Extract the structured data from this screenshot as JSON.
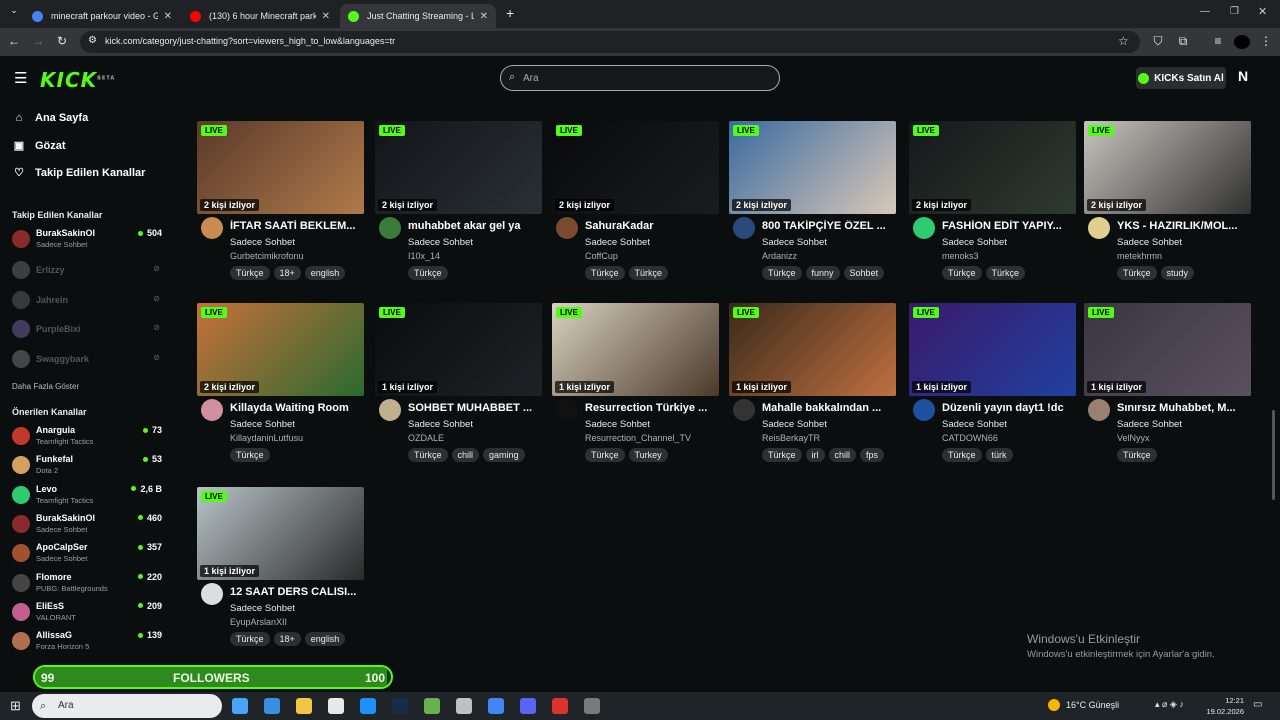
{
  "browser": {
    "tabs": [
      {
        "title": "minecraft parkour video - Google",
        "fav": "#4285f4",
        "active": false
      },
      {
        "title": "(130) 6 hour Minecraft parkour",
        "fav": "#ff0000",
        "active": false
      },
      {
        "title": "Just Chatting Streaming - Live S",
        "fav": "#53fc18",
        "active": true
      }
    ],
    "url": "kick.com/category/just-chatting?sort=viewers_high_to_low&languages=tr",
    "new_tab": "+"
  },
  "header": {
    "logo": "KICK",
    "logo_tag": "BETA",
    "search_placeholder": "Ara",
    "kicks_button": "KICKs Satın Al",
    "user_initial": "N"
  },
  "sidebar": {
    "nav": [
      {
        "label": "Ana Sayfa",
        "icon": "home-icon"
      },
      {
        "label": "Gözat",
        "icon": "browse-icon"
      },
      {
        "label": "Takip Edilen Kanallar",
        "icon": "heart-icon"
      }
    ],
    "followed_title": "Takip Edilen Kanallar",
    "followed": [
      {
        "name": "BurakSakinOl",
        "sub": "Sadece Sohbet",
        "viewers": "504",
        "online": true,
        "color": "#8b2a2a"
      },
      {
        "name": "Erlizzy",
        "online": false,
        "color": "#888"
      },
      {
        "name": "Jahrein",
        "online": false,
        "color": "#777"
      },
      {
        "name": "PurpleBixi",
        "online": false,
        "color": "#9b7fd0"
      },
      {
        "name": "Swaggybark",
        "online": false,
        "color": "#999"
      }
    ],
    "more_label": "Daha Fazla Göster",
    "suggested_title": "Önerilen Kanallar",
    "suggested": [
      {
        "name": "Anarguia",
        "sub": "Teamfight Tactics",
        "viewers": "73",
        "color": "#c0392b"
      },
      {
        "name": "Funkefal",
        "sub": "Dota 2",
        "viewers": "53",
        "color": "#d4a060"
      },
      {
        "name": "Levo",
        "sub": "Teamfight Tactics",
        "viewers": "2,6 B",
        "color": "#2ecc71"
      },
      {
        "name": "BurakSakinOl",
        "sub": "Sadece Sohbet",
        "viewers": "460",
        "color": "#8b2a2a"
      },
      {
        "name": "ApoCalpSer",
        "sub": "Sadece Sohbet",
        "viewers": "357",
        "color": "#a0522d"
      },
      {
        "name": "Flomore",
        "sub": "PUBG: Battlegrounds",
        "viewers": "220",
        "color": "#444"
      },
      {
        "name": "EliEsS",
        "sub": "VALORANT",
        "viewers": "209",
        "color": "#c06090"
      },
      {
        "name": "AllissaG",
        "sub": "Forza Horizon 5",
        "viewers": "139",
        "color": "#b07050"
      }
    ]
  },
  "follow_goal": {
    "start": "99",
    "label": "FOLLOWERS",
    "end": "100",
    "progress": 0.99
  },
  "streams": [
    {
      "title": "İFTAR SAATİ BEKLEM...",
      "category": "Sadece Sohbet",
      "user": "Gurbetcimikrofonu",
      "viewers": "2 kişi izliyor",
      "tags": [
        "Türkçe",
        "18+",
        "english"
      ],
      "thumb": "#5a3a2a",
      "thumb2": "#b07a4a",
      "avatar": "#c98b50"
    },
    {
      "title": "muhabbet akar gel ya",
      "category": "Sadece Sohbet",
      "user": "I10x_14",
      "viewers": "2 kişi izliyor",
      "tags": [
        "Türkçe"
      ],
      "thumb": "#121418",
      "thumb2": "#2a3035",
      "avatar": "#3a7d3a"
    },
    {
      "title": "SahuraKadar",
      "category": "Sadece Sohbet",
      "user": "CoffCup",
      "viewers": "2 kişi izliyor",
      "tags": [
        "Türkçe",
        "Türkçe"
      ],
      "thumb": "#0a0a0c",
      "thumb2": "#1a1c20",
      "avatar": "#7a4a30"
    },
    {
      "title": "800 TAKİPÇİYE ÖZEL ...",
      "category": "Sadece Sohbet",
      "user": "Ardanizz",
      "viewers": "2 kişi izliyor",
      "tags": [
        "Türkçe",
        "funny",
        "Sohbet"
      ],
      "thumb": "#3a6aa0",
      "thumb2": "#d8c8b8",
      "avatar": "#2a4a7a"
    },
    {
      "title": "FASHİON EDİT YAPIY...",
      "category": "Sadece Sohbet",
      "user": "menoks3",
      "viewers": "2 kişi izliyor",
      "tags": [
        "Türkçe",
        "Türkçe"
      ],
      "thumb": "#15181a",
      "thumb2": "#2e3a30",
      "avatar": "#2ecc71"
    },
    {
      "title": "YKS - HAZIRLIK/MOL...",
      "category": "Sadece Sohbet",
      "user": "metekhrmn",
      "viewers": "2 kişi izliyor",
      "tags": [
        "Türkçe",
        "study"
      ],
      "thumb": "#c8c4be",
      "thumb2": "#303030",
      "avatar": "#e0d090"
    },
    {
      "title": "Killayda Waiting Room",
      "category": "Sadece Sohbet",
      "user": "KillaydaninLutfusu",
      "viewers": "2 kişi izliyor",
      "tags": [
        "Türkçe"
      ],
      "thumb": "#c8703a",
      "thumb2": "#2a6a30",
      "avatar": "#d090a0"
    },
    {
      "title": "SOHBET MUHABBET ...",
      "category": "Sadece Sohbet",
      "user": "OZDALE",
      "viewers": "1 kişi izliyor",
      "tags": [
        "Türkçe",
        "chill",
        "gaming"
      ],
      "thumb": "#0a0c0e",
      "thumb2": "#1e2226",
      "avatar": "#c0b090"
    },
    {
      "title": "Resurrection Türkiye ...",
      "category": "Sadece Sohbet",
      "user": "Resurrection_Channel_TV",
      "viewers": "1 kişi izliyor",
      "tags": [
        "Türkçe",
        "Turkey"
      ],
      "thumb": "#d8d0c0",
      "thumb2": "#4a3a2a",
      "avatar": "#111"
    },
    {
      "title": "Mahalle bakkalından ...",
      "category": "Sadece Sohbet",
      "user": "ReisBerkayTR",
      "viewers": "1 kişi izliyor",
      "tags": [
        "Türkçe",
        "irl",
        "chill",
        "fps"
      ],
      "thumb": "#3a2a1a",
      "thumb2": "#c07040",
      "avatar": "#333"
    },
    {
      "title": "Düzenli yayın dayt1 !dc",
      "category": "Sadece Sohbet",
      "user": "CATDOWN66",
      "viewers": "1 kişi izliyor",
      "tags": [
        "Türkçe",
        "türk"
      ],
      "thumb": "#3a1a6a",
      "thumb2": "#2040a0",
      "avatar": "#2050a0"
    },
    {
      "title": "Sınırsız Muhabbet, M...",
      "category": "Sadece Sohbet",
      "user": "VelNyyx",
      "viewers": "1 kişi izliyor",
      "tags": [
        "Türkçe"
      ],
      "thumb": "#3a3642",
      "thumb2": "#5a5060",
      "avatar": "#9a8070"
    },
    {
      "title": "12 SAAT DERS CALISI...",
      "category": "Sadece Sohbet",
      "user": "EyupArslanXII",
      "viewers": "1 kişi izliyor",
      "tags": [
        "Türkçe",
        "18+",
        "english"
      ],
      "thumb": "#b8c4c8",
      "thumb2": "#2a2a2a",
      "avatar": "#ddd"
    }
  ],
  "live_label": "LIVE",
  "watermark": {
    "title": "Windows'u Etkinleştir",
    "sub": "Windows'u etkinleştirmek için Ayarlar'a gidin."
  },
  "taskbar": {
    "search": "Ara",
    "weather": "16°C  Güneşli",
    "time": "12:21",
    "date": "19.02.2026",
    "apps": [
      "#4aa3ff",
      "#3a8ee6",
      "#f4c542",
      "#e8e8e8",
      "#1e90ff",
      "#1a2a4a",
      "#6ab04c",
      "#c0c0c0",
      "#4285f4",
      "#5865f2",
      "#e03030",
      "#7a7a7a"
    ]
  }
}
